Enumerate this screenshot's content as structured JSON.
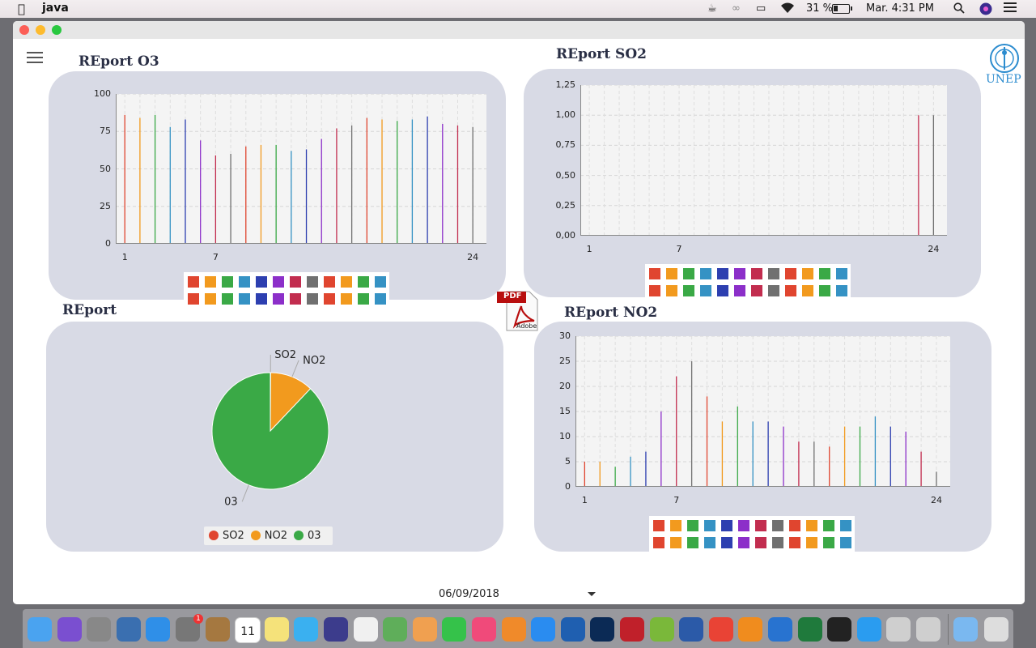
{
  "menubar": {
    "app_name": "java",
    "battery_percent": "31 %",
    "clock": "Mar. 4:31 PM"
  },
  "brand": {
    "logo_text": "UNEP"
  },
  "panels": {
    "o3": {
      "title": "REport O3"
    },
    "so2": {
      "title": "REport SO2"
    },
    "pie": {
      "title": "REport"
    },
    "no2": {
      "title": "REport NO2"
    }
  },
  "date_picker": {
    "value": "06/09/2018"
  },
  "pdf_icon": {
    "label": "PDF",
    "brand": "Adobe"
  },
  "colors": {
    "panel_bg": "#d8dae5",
    "series_cycle": [
      "#e0452f",
      "#f29a1e",
      "#3aa946",
      "#3592c4",
      "#2d3fb0",
      "#8c2fc9",
      "#c22d4f",
      "#707070"
    ]
  },
  "chart_data": [
    {
      "type": "bar",
      "title": "REport O3",
      "x": [
        1,
        2,
        3,
        4,
        5,
        6,
        7,
        8,
        9,
        10,
        11,
        12,
        13,
        14,
        15,
        16,
        17,
        18,
        19,
        20,
        21,
        22,
        23,
        24
      ],
      "values": [
        86,
        84,
        86,
        78,
        83,
        69,
        59,
        60,
        65,
        66,
        66,
        62,
        63,
        70,
        77,
        79,
        84,
        83,
        82,
        83,
        85,
        80,
        79,
        78
      ],
      "ylim": [
        0,
        100
      ],
      "yticks": [
        "0",
        "25",
        "50",
        "75",
        "100"
      ],
      "xticks": [
        "1",
        "7",
        "24"
      ],
      "grid": true
    },
    {
      "type": "bar",
      "title": "REport SO2",
      "x": [
        1,
        2,
        3,
        4,
        5,
        6,
        7,
        8,
        9,
        10,
        11,
        12,
        13,
        14,
        15,
        16,
        17,
        18,
        19,
        20,
        21,
        22,
        23,
        24
      ],
      "values": [
        0,
        0,
        0,
        0,
        0,
        0,
        0,
        0,
        0,
        0,
        0,
        0,
        0,
        0,
        0,
        0,
        0,
        0,
        0,
        0,
        0,
        0,
        1,
        1
      ],
      "ylim": [
        0,
        1.25
      ],
      "yticks": [
        "0,00",
        "0,25",
        "0,50",
        "0,75",
        "1,00",
        "1,25"
      ],
      "xticks": [
        "1",
        "7",
        "24"
      ],
      "grid": true
    },
    {
      "type": "pie",
      "title": "REport",
      "labels": [
        "SO2",
        "NO2",
        "03"
      ],
      "values": [
        0.1,
        12,
        88
      ],
      "colors": [
        "#e0452f",
        "#f29a1e",
        "#3aa946"
      ],
      "legend": "bottom"
    },
    {
      "type": "bar",
      "title": "REport NO2",
      "x": [
        1,
        2,
        3,
        4,
        5,
        6,
        7,
        8,
        9,
        10,
        11,
        12,
        13,
        14,
        15,
        16,
        17,
        18,
        19,
        20,
        21,
        22,
        23,
        24
      ],
      "values": [
        5,
        5,
        4,
        6,
        7,
        15,
        22,
        25,
        18,
        13,
        16,
        13,
        13,
        12,
        9,
        9,
        8,
        12,
        12,
        14,
        12,
        11,
        7,
        3
      ],
      "ylim": [
        0,
        30
      ],
      "yticks": [
        "0",
        "5",
        "10",
        "15",
        "20",
        "25",
        "30"
      ],
      "xticks": [
        "1",
        "7",
        "24"
      ],
      "grid": true
    }
  ],
  "dock": {
    "icons": [
      "finder-icon",
      "siri-icon",
      "launchpad-icon",
      "preview-icon",
      "safari-icon",
      "system-preferences-icon",
      "notes-brown-icon",
      "calendar-icon",
      "notes-icon",
      "messages-icon",
      "phpstorm-icon",
      "textedit-icon",
      "maps-icon",
      "photos-icon",
      "facetime-icon",
      "itunes-icon",
      "ibooks-icon",
      "app-store-icon",
      "virtualbox-icon",
      "photoshop-icon",
      "ruby-icon",
      "android-studio-icon",
      "word-icon",
      "chrome-icon",
      "sublime-icon",
      "vscode-icon",
      "excel-icon",
      "pointer-icon",
      "keynote-icon",
      "java-icon",
      "java-icon-2",
      "folder-icon",
      "trash-icon"
    ],
    "calendar_day": "11",
    "notification_badge": "1"
  }
}
